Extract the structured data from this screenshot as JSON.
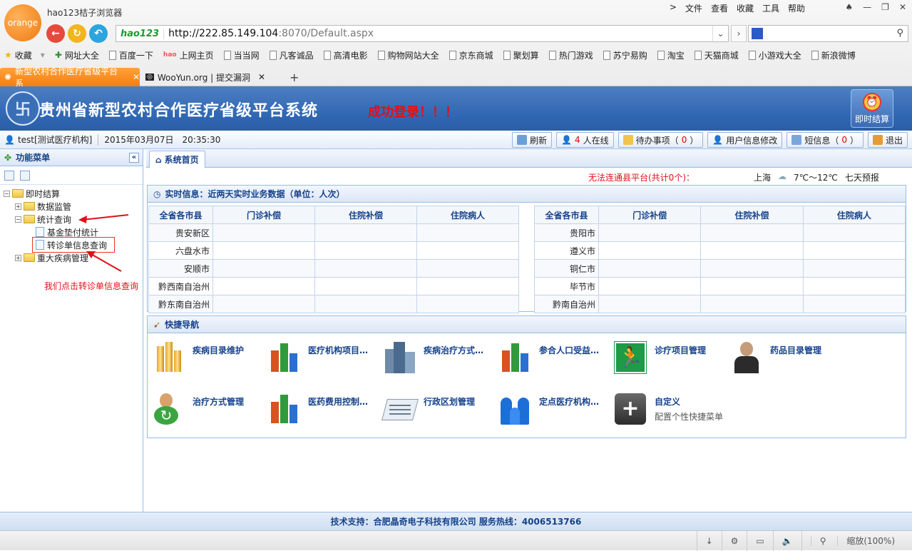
{
  "browser": {
    "logo_text": "orange",
    "title": "hao123桔子浏览器",
    "menu": [
      "文件",
      "查看",
      "收藏",
      "工具",
      "帮助"
    ],
    "address": {
      "brand": "hao123",
      "url_host": "http://222.85.149.104",
      "url_port": ":8070",
      "url_path": "/Default.aspx"
    },
    "bookmarks": [
      "收藏",
      "网址大全",
      "百度一下",
      "上网主页",
      "当当网",
      "凡客诚品",
      "高清电影",
      "购物网站大全",
      "京东商城",
      "聚划算",
      "热门游戏",
      "苏宁易购",
      "淘宝",
      "天猫商城",
      "小游戏大全",
      "新浪微博"
    ],
    "tabs": [
      {
        "title": "新型农村合作医疗省级平台系"
      },
      {
        "title": "WooYun.org | 提交漏洞"
      }
    ],
    "zoom": "缩放(100%)"
  },
  "app": {
    "title": "贵州省新型农村合作医疗省级平台系统",
    "login_msg": "成功登录！！！",
    "quick_settle": "即时结算",
    "user": "test[测试医疗机构]",
    "date": "2015年03月07日",
    "time": "20:35:30",
    "toolbar": {
      "refresh": "刷新",
      "online_count": "4",
      "online_suffix": "人在线",
      "todo": "待办事项（",
      "todo_count": "0",
      "profile": "用户信息修改",
      "sms": "短信息（",
      "sms_count": "0",
      "close_paren": "）",
      "logout": "退出"
    }
  },
  "sidebar": {
    "title": "功能菜单",
    "collapse": "«",
    "tree": [
      {
        "label": "即时结算",
        "level": 0,
        "type": "folder",
        "toggle": "−"
      },
      {
        "label": "数据监管",
        "level": 1,
        "type": "folder",
        "toggle": "+"
      },
      {
        "label": "统计查询",
        "level": 1,
        "type": "folder",
        "toggle": "−"
      },
      {
        "label": "基金垫付统计",
        "level": 2,
        "type": "doc"
      },
      {
        "label": "转诊单信息查询",
        "level": 2,
        "type": "doc",
        "highlight": true
      },
      {
        "label": "重大疾病管理",
        "level": 1,
        "type": "folder",
        "toggle": "+"
      }
    ],
    "annotation": "我们点击转诊单信息查询"
  },
  "main": {
    "tab": "系统首页",
    "warning": "无法连通县平台(共计0个)：",
    "weather": {
      "city": "上海",
      "temp": "7℃～12℃",
      "forecast": "七天预报"
    },
    "realtime_title": "实时信息：近两天实时业务数据（单位：人次）",
    "table_headers": [
      "全省各市县",
      "门诊补偿",
      "住院补偿",
      "住院病人"
    ],
    "left_cities": [
      "贵安新区",
      "六盘水市",
      "安顺市",
      "黔西南自治州",
      "黔东南自治州"
    ],
    "right_cities": [
      "贵阳市",
      "遵义市",
      "铜仁市",
      "毕节市",
      "黔南自治州"
    ],
    "shortcut_title": "快捷导航",
    "shortcuts": [
      {
        "label": "疾病目录维护",
        "icon": "coins-icon"
      },
      {
        "label": "医疗机构项目…",
        "icon": "bar-chart-icon"
      },
      {
        "label": "疾病治疗方式…",
        "icon": "buildings-icon"
      },
      {
        "label": "参合人口受益…",
        "icon": "bar-chart-icon"
      },
      {
        "label": "诊疗项目管理",
        "icon": "exit-sign-icon"
      },
      {
        "label": "药品目录管理",
        "icon": "businessman-icon"
      },
      {
        "label": "治疗方式管理",
        "icon": "user-refresh-icon"
      },
      {
        "label": "医药费用控制…",
        "icon": "bar-chart-icon"
      },
      {
        "label": "行政区划管理",
        "icon": "phonebook-icon"
      },
      {
        "label": "定点医疗机构…",
        "icon": "family-icon"
      },
      {
        "label": "自定义",
        "sub": "配置个性快捷菜单",
        "icon": "plus-icon"
      }
    ]
  },
  "footer": "技术支持：合肥晶奇电子科技有限公司 服务热线：4006513766"
}
